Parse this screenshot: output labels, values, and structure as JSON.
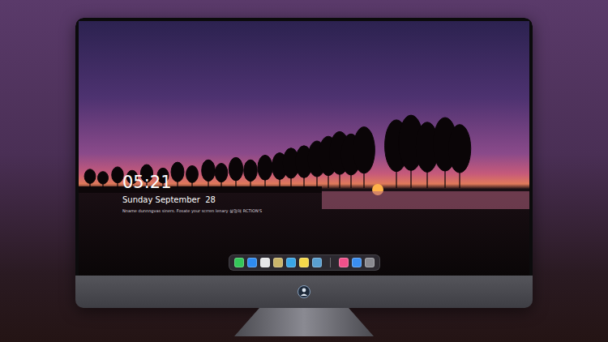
{
  "screen": {
    "clock": "05:21",
    "date": "Sunday September  28",
    "notice": "Nname dunnngvas siners. Fosate your scrren lenary 설명해 RCTION'S",
    "dock": {
      "items": [
        {
          "kind": "app",
          "color": "#34c759"
        },
        {
          "kind": "app",
          "color": "#2e8bf0"
        },
        {
          "kind": "app",
          "color": "#e6e6e8"
        },
        {
          "kind": "app",
          "color": "#c9b46a"
        },
        {
          "kind": "app",
          "color": "#3aa6e6"
        },
        {
          "kind": "app",
          "color": "#f5d84a"
        },
        {
          "kind": "app",
          "color": "#5a9fd0"
        },
        {
          "kind": "divider"
        },
        {
          "kind": "app",
          "color": "#f0508a"
        },
        {
          "kind": "app",
          "color": "#3a8ef0"
        },
        {
          "kind": "app",
          "color": "#8a8a90"
        }
      ]
    }
  }
}
